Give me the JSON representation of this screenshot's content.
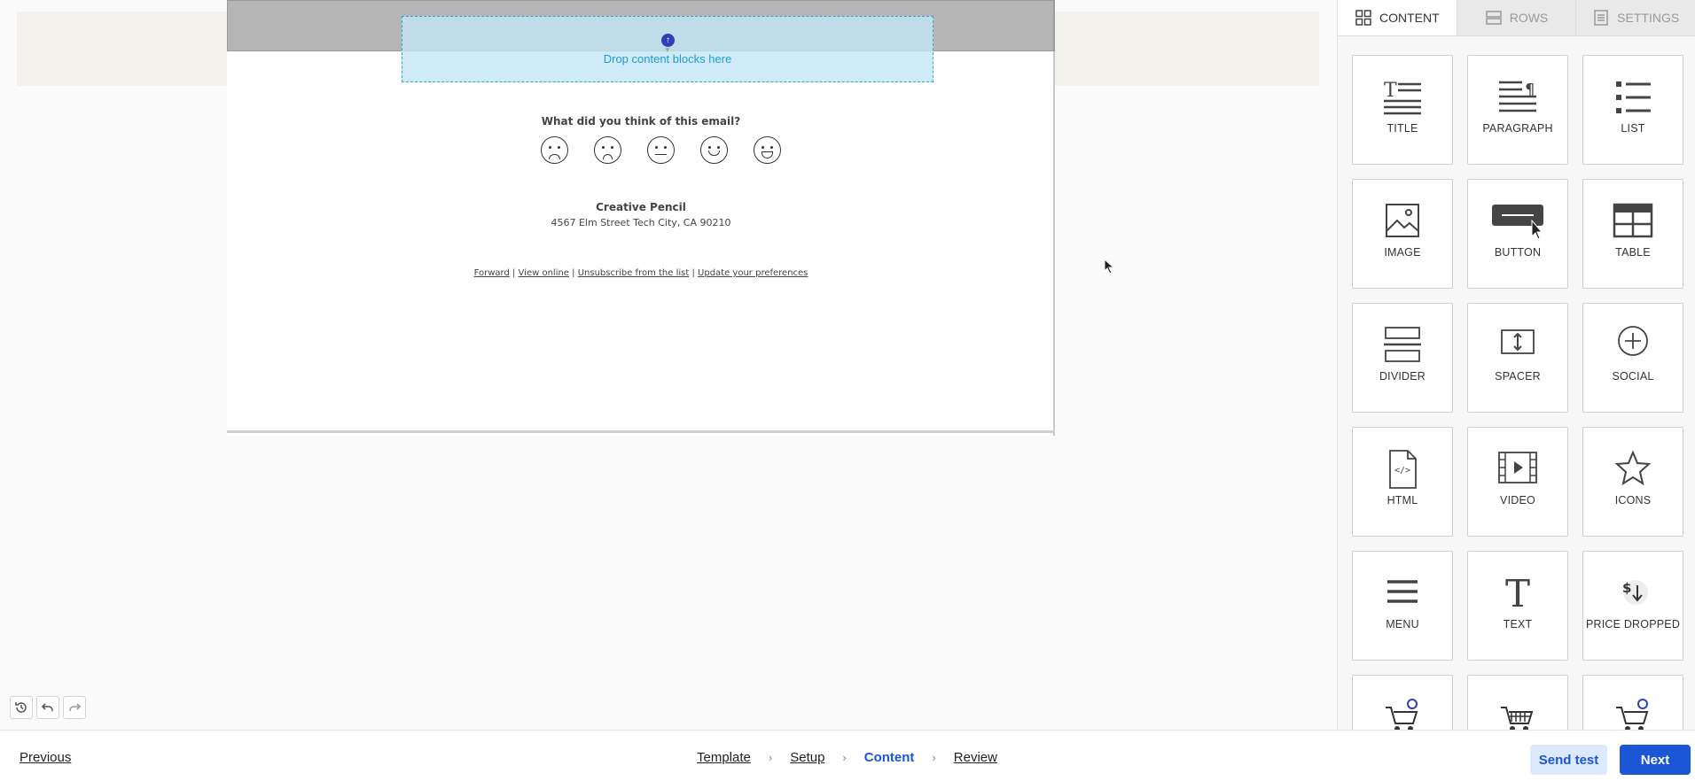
{
  "canvas": {
    "dropzone_label": "Drop content blocks here",
    "survey_question": "What did you think of this email?",
    "company_name": "Creative Pencil",
    "company_address": "4567 Elm Street Tech City, CA 90210",
    "footer_links": [
      "Forward",
      "View online",
      "Unsubscribe from the list",
      "Update your preferences"
    ],
    "footer_separator": "|"
  },
  "panel": {
    "tabs": [
      {
        "label": "CONTENT",
        "icon": "grid-icon",
        "active": true
      },
      {
        "label": "ROWS",
        "icon": "rows-icon",
        "active": false
      },
      {
        "label": "SETTINGS",
        "icon": "settings-doc-icon",
        "active": false
      }
    ],
    "blocks": [
      {
        "label": "TITLE",
        "icon": "title-icon"
      },
      {
        "label": "PARAGRAPH",
        "icon": "paragraph-icon"
      },
      {
        "label": "LIST",
        "icon": "list-icon"
      },
      {
        "label": "IMAGE",
        "icon": "image-icon"
      },
      {
        "label": "BUTTON",
        "icon": "button-icon"
      },
      {
        "label": "TABLE",
        "icon": "table-icon"
      },
      {
        "label": "DIVIDER",
        "icon": "divider-icon"
      },
      {
        "label": "SPACER",
        "icon": "spacer-icon"
      },
      {
        "label": "SOCIAL",
        "icon": "social-icon"
      },
      {
        "label": "HTML",
        "icon": "html-icon"
      },
      {
        "label": "VIDEO",
        "icon": "video-icon"
      },
      {
        "label": "ICONS",
        "icon": "star-icon"
      },
      {
        "label": "MENU",
        "icon": "menu-icon"
      },
      {
        "label": "TEXT",
        "icon": "text-icon"
      },
      {
        "label": "PRICE DROPPED",
        "icon": "price-dropped-icon"
      },
      {
        "label": "",
        "icon": "cart-icon"
      },
      {
        "label": "",
        "icon": "cart-icon"
      },
      {
        "label": "",
        "icon": "cart-icon"
      }
    ]
  },
  "bottombar": {
    "previous_label": "Previous",
    "steps": [
      "Template",
      "Setup",
      "Content",
      "Review"
    ],
    "active_step": "Content",
    "send_test_label": "Send test",
    "next_label": "Next"
  },
  "colors": {
    "accent": "#1a56d6",
    "dropzone_text": "#1f9bd6"
  }
}
